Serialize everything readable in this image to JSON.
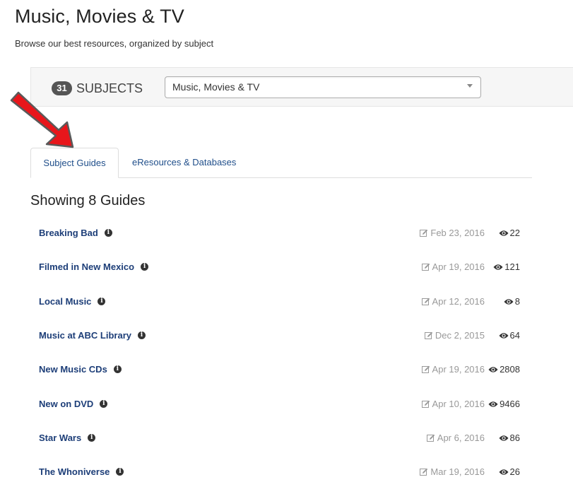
{
  "header": {
    "title": "Music, Movies & TV",
    "subtitle": "Browse our best resources, organized by subject"
  },
  "subject_bar": {
    "count": "31",
    "label": "SUBJECTS",
    "selected_subject": "Music, Movies & TV"
  },
  "tabs": [
    {
      "label": "Subject Guides",
      "active": true
    },
    {
      "label": "eResources & Databases",
      "active": false
    }
  ],
  "results": {
    "heading": "Showing 8 Guides",
    "guides": [
      {
        "title": "Breaking Bad",
        "date": "Feb 23, 2016",
        "views": "22"
      },
      {
        "title": "Filmed in New Mexico",
        "date": "Apr 19, 2016",
        "views": "121"
      },
      {
        "title": "Local Music",
        "date": "Apr 12, 2016",
        "views": "8"
      },
      {
        "title": "Music at ABC Library",
        "date": "Dec 2, 2015",
        "views": "64"
      },
      {
        "title": "New Music CDs",
        "date": "Apr 19, 2016",
        "views": "2808"
      },
      {
        "title": "New on DVD",
        "date": "Apr 10, 2016",
        "views": "9466"
      },
      {
        "title": "Star Wars",
        "date": "Apr 6, 2016",
        "views": "86"
      },
      {
        "title": "The Whoniverse",
        "date": "Mar 19, 2016",
        "views": "26"
      }
    ]
  },
  "colors": {
    "link": "#1d3e78",
    "tab_link": "#1f4e8a",
    "badge": "#555555",
    "annotation_arrow": "#e8161b"
  },
  "icons": [
    "info-icon",
    "edit-icon",
    "eye-icon",
    "chevron-down-icon",
    "red-arrow-icon"
  ]
}
